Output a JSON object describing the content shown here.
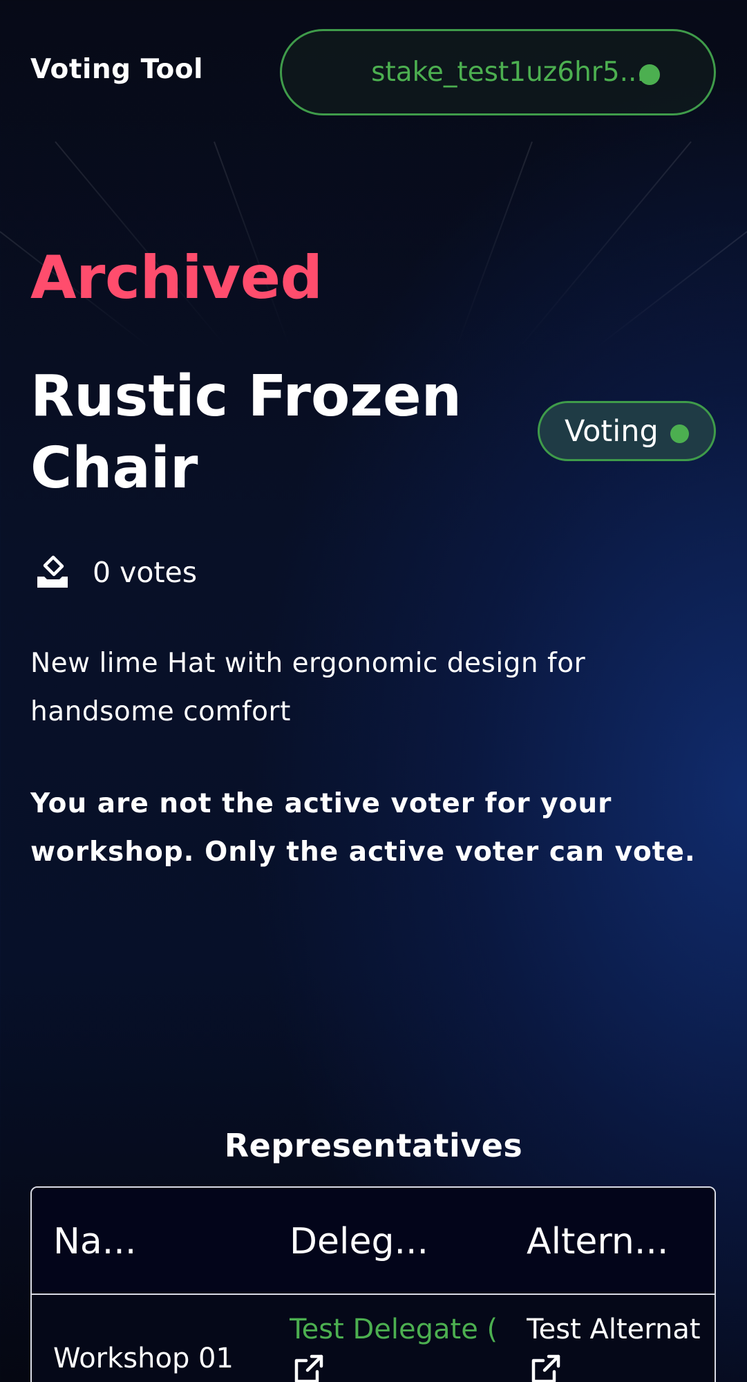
{
  "header": {
    "app_title": "Voting Tool",
    "wallet_address": "stake_test1uz6hr5...",
    "wallet_status_color": "#4caf50"
  },
  "proposal": {
    "archive_label": "Archived",
    "title": "Rustic Frozen Chair",
    "status": "Voting",
    "votes_text": "0 votes",
    "description": "New lime Hat with ergonomic design for handsome comfort",
    "notice": "You are not the active voter for your workshop. Only the active voter can vote."
  },
  "representatives": {
    "heading": "Representatives",
    "columns": [
      "Na...",
      "Deleg...",
      "Altern..."
    ],
    "rows": [
      {
        "name": "Workshop 01",
        "delegate": "Test Delegate (",
        "alternate": "Test Alternat"
      }
    ]
  },
  "icons": {
    "votes": "ballot-box-icon",
    "external": "external-link-icon"
  },
  "colors": {
    "accent_green": "#4caf50",
    "archived_red": "#ff4d6d",
    "badge_bg": "#1f3b45"
  }
}
